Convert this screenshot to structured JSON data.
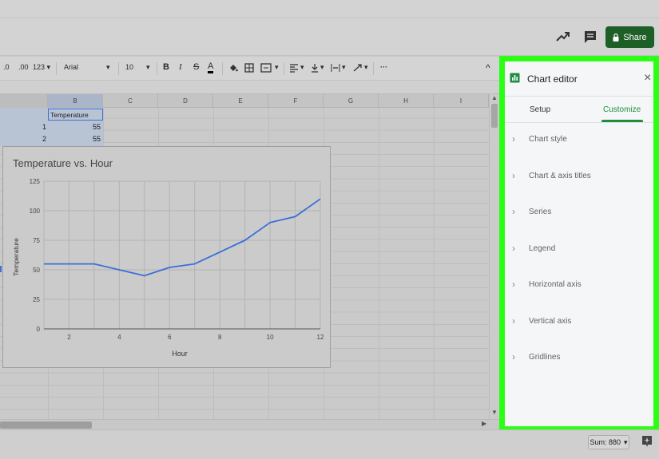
{
  "header": {
    "share_label": "Share",
    "icons": [
      "trending-up-icon",
      "comment-icon",
      "lock-icon"
    ]
  },
  "toolbar": {
    "decimal_decrease": ".0",
    "decimal_increase": ".00",
    "format_more": "123",
    "font": "Arial",
    "font_size": "10",
    "bold": "B",
    "italic": "I",
    "strike": "S",
    "text_color": "A",
    "more": "···",
    "collapse": "^"
  },
  "sheet": {
    "columns": [
      "B",
      "C",
      "D",
      "E",
      "F",
      "G",
      "H",
      "I"
    ],
    "header_cell": "Temperature",
    "rows": [
      {
        "a": "1",
        "b": "55"
      },
      {
        "a": "2",
        "b": "55"
      }
    ]
  },
  "chart_data": {
    "type": "line",
    "title": "Temperature vs. Hour",
    "xlabel": "Hour",
    "ylabel": "Temperature",
    "x": [
      1,
      2,
      3,
      4,
      5,
      6,
      7,
      8,
      9,
      10,
      11,
      12
    ],
    "series": [
      {
        "values": [
          55,
          55,
          55,
          50,
          45,
          52,
          55,
          65,
          75,
          90,
          95,
          110
        ]
      }
    ],
    "xlim": [
      1,
      12
    ],
    "ylim": [
      0,
      125
    ],
    "x_ticks": [
      "2",
      "4",
      "6",
      "8",
      "10",
      "12"
    ],
    "y_ticks": [
      "0",
      "25",
      "50",
      "75",
      "100",
      "125"
    ],
    "grid": true,
    "line_color": "#3a6fd8"
  },
  "editor": {
    "title": "Chart editor",
    "close": "×",
    "tabs": [
      {
        "label": "Setup",
        "active": false
      },
      {
        "label": "Customize",
        "active": true
      }
    ],
    "sections": [
      "Chart style",
      "Chart & axis titles",
      "Series",
      "Legend",
      "Horizontal axis",
      "Vertical axis",
      "Gridlines"
    ]
  },
  "status": {
    "sum": "Sum: 880"
  },
  "colors": {
    "accent_green": "#1e8e3e",
    "highlight_border": "#2aff14",
    "share_bg": "#1e5e27"
  }
}
